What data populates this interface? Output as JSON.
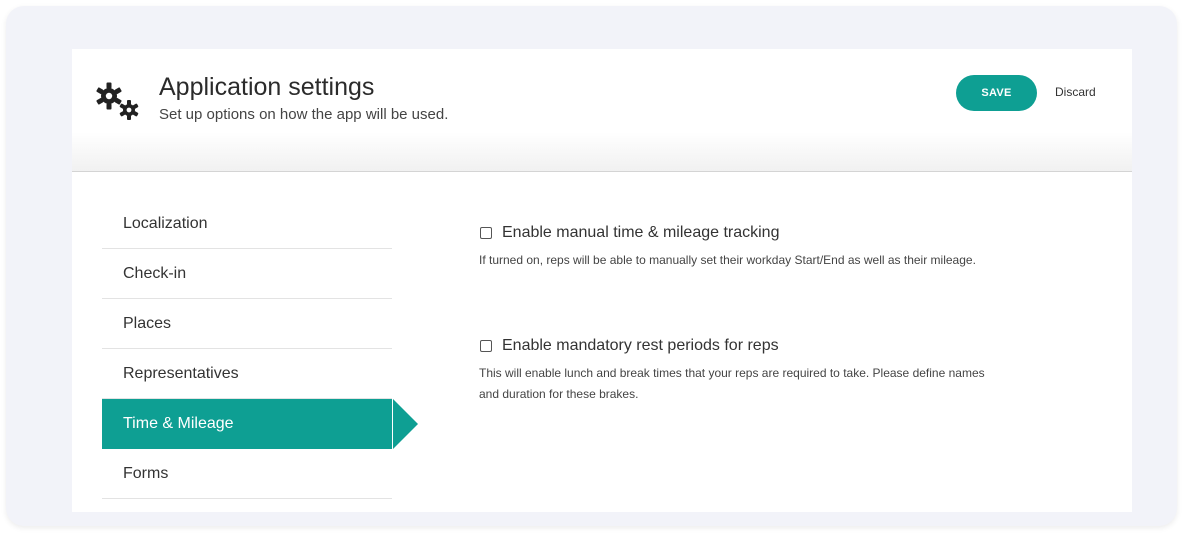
{
  "header": {
    "title": "Application settings",
    "subtitle": "Set up options on how the app will be used.",
    "icon": "gears-icon",
    "save_label": "SAVE",
    "discard_label": "Discard"
  },
  "sidebar": {
    "items": [
      {
        "label": "Localization",
        "active": false
      },
      {
        "label": "Check-in",
        "active": false
      },
      {
        "label": "Places",
        "active": false
      },
      {
        "label": "Representatives",
        "active": false
      },
      {
        "label": "Time & Mileage",
        "active": true
      },
      {
        "label": "Forms",
        "active": false
      }
    ]
  },
  "options": [
    {
      "label": "Enable manual time & mileage tracking",
      "checked": false,
      "description": "If turned on, reps will be able to manually set their workday Start/End as well as their mileage."
    },
    {
      "label": "Enable mandatory rest periods for reps",
      "checked": false,
      "description": "This will enable lunch and break times that your reps are required to take. Please define names and duration for these brakes."
    }
  ],
  "colors": {
    "accent": "#0e9f93",
    "frame_background": "#f2f3f9"
  }
}
